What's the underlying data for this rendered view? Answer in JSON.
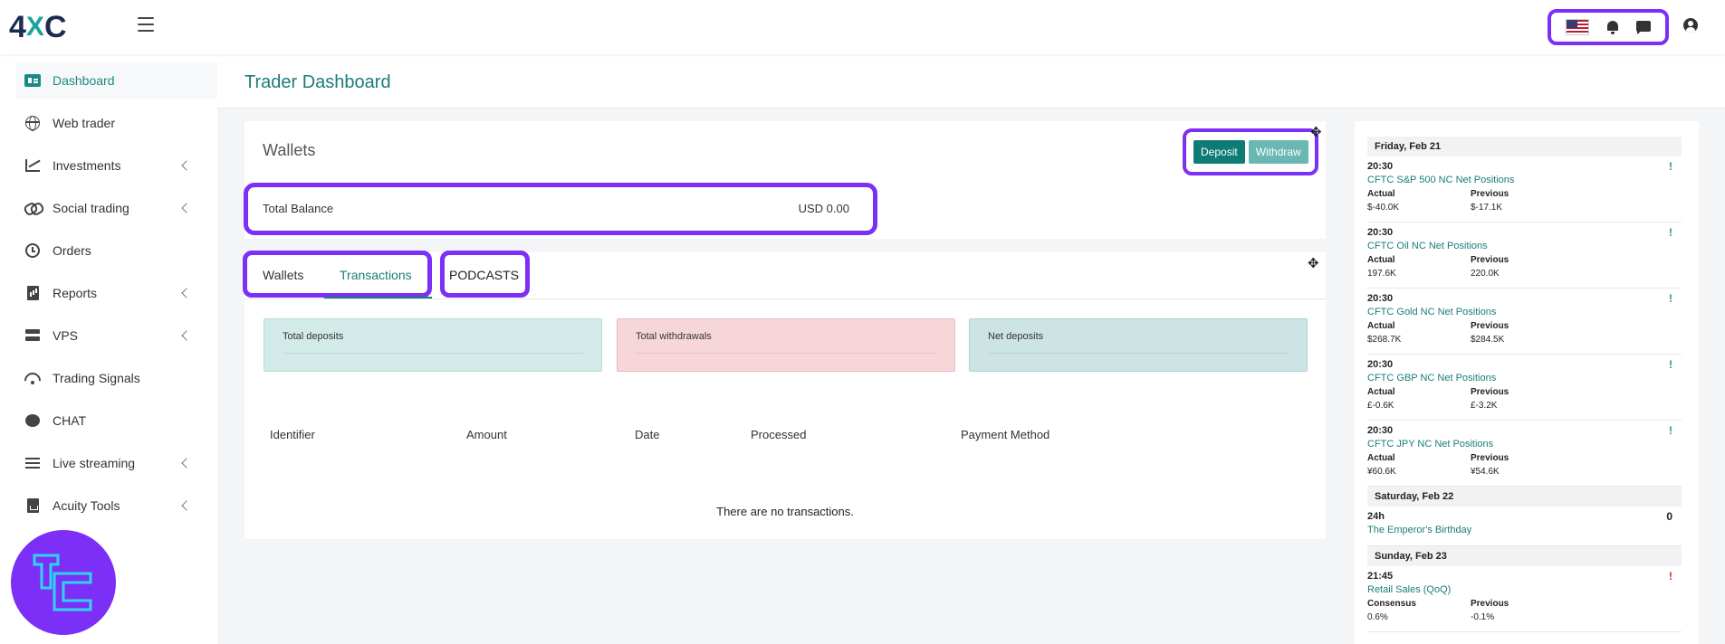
{
  "brand": {
    "logo_main": "4",
    "logo_x": "X",
    "logo_end": "C"
  },
  "topbar": {
    "menu_icon": "hamburger-icon",
    "icons": [
      "us-flag-icon",
      "bell-icon",
      "message-icon",
      "user-icon"
    ]
  },
  "sidebar": {
    "items": [
      {
        "label": "Dashboard",
        "icon": "dashboard-icon",
        "active": true
      },
      {
        "label": "Web trader",
        "icon": "globe-icon"
      },
      {
        "label": "Investments",
        "icon": "chart-icon",
        "expandable": true
      },
      {
        "label": "Social trading",
        "icon": "link-icon",
        "expandable": true
      },
      {
        "label": "Orders",
        "icon": "history-icon"
      },
      {
        "label": "Reports",
        "icon": "report-icon",
        "expandable": true
      },
      {
        "label": "VPS",
        "icon": "server-icon",
        "expandable": true
      },
      {
        "label": "Trading Signals",
        "icon": "wifi-icon"
      },
      {
        "label": "CHAT",
        "icon": "chat-icon"
      },
      {
        "label": "Live streaming",
        "icon": "list-icon",
        "expandable": true
      },
      {
        "label": "Acuity Tools",
        "icon": "tools-icon",
        "expandable": true
      }
    ],
    "watermark": "TC"
  },
  "page": {
    "title": "Trader Dashboard"
  },
  "wallets": {
    "title": "Wallets",
    "deposit_label": "Deposit",
    "withdraw_label": "Withdraw",
    "total_balance_label": "Total Balance",
    "total_balance_value": "USD 0.00"
  },
  "tabs": [
    {
      "label": "Wallets"
    },
    {
      "label": "Transactions",
      "active": true
    },
    {
      "label": "PODCASTS"
    }
  ],
  "stats": {
    "deposits_label": "Total deposits",
    "withdrawals_label": "Total withdrawals",
    "net_label": "Net deposits"
  },
  "table": {
    "columns": [
      "Identifier",
      "Amount",
      "Date",
      "Processed",
      "Payment Method"
    ],
    "empty_message": "There are no transactions."
  },
  "calendar": [
    {
      "day": "Friday, Feb 21",
      "events": [
        {
          "time": "20:30",
          "name": "CFTC S&P 500 NC Net Positions",
          "impact": "!",
          "impact_color": "#27a34a",
          "k1": "Actual",
          "v1": "$-40.0K",
          "k2": "Previous",
          "v2": "$-17.1K"
        },
        {
          "time": "20:30",
          "name": "CFTC Oil NC Net Positions",
          "impact": "!",
          "impact_color": "#27a34a",
          "k1": "Actual",
          "v1": "197.6K",
          "k2": "Previous",
          "v2": "220.0K"
        },
        {
          "time": "20:30",
          "name": "CFTC Gold NC Net Positions",
          "impact": "!",
          "impact_color": "#27a34a",
          "k1": "Actual",
          "v1": "$268.7K",
          "k2": "Previous",
          "v2": "$284.5K"
        },
        {
          "time": "20:30",
          "name": "CFTC GBP NC Net Positions",
          "impact": "!",
          "impact_color": "#27a34a",
          "k1": "Actual",
          "v1": "£-0.6K",
          "k2": "Previous",
          "v2": "£-3.2K"
        },
        {
          "time": "20:30",
          "name": "CFTC JPY NC Net Positions",
          "impact": "!",
          "impact_color": "#27a34a",
          "k1": "Actual",
          "v1": "¥60.6K",
          "k2": "Previous",
          "v2": "¥54.6K"
        }
      ]
    },
    {
      "day": "Saturday, Feb 22",
      "events": [
        {
          "time": "24h",
          "name": "The Emperor's Birthday",
          "impact": "0",
          "impact_color": "#222222"
        }
      ]
    },
    {
      "day": "Sunday, Feb 23",
      "events": [
        {
          "time": "21:45",
          "name": "Retail Sales (QoQ)",
          "impact": "!",
          "impact_color": "#d12b2b",
          "k1": "Consensus",
          "v1": "0.6%",
          "k2": "Previous",
          "v2": "-0.1%"
        }
      ]
    }
  ]
}
